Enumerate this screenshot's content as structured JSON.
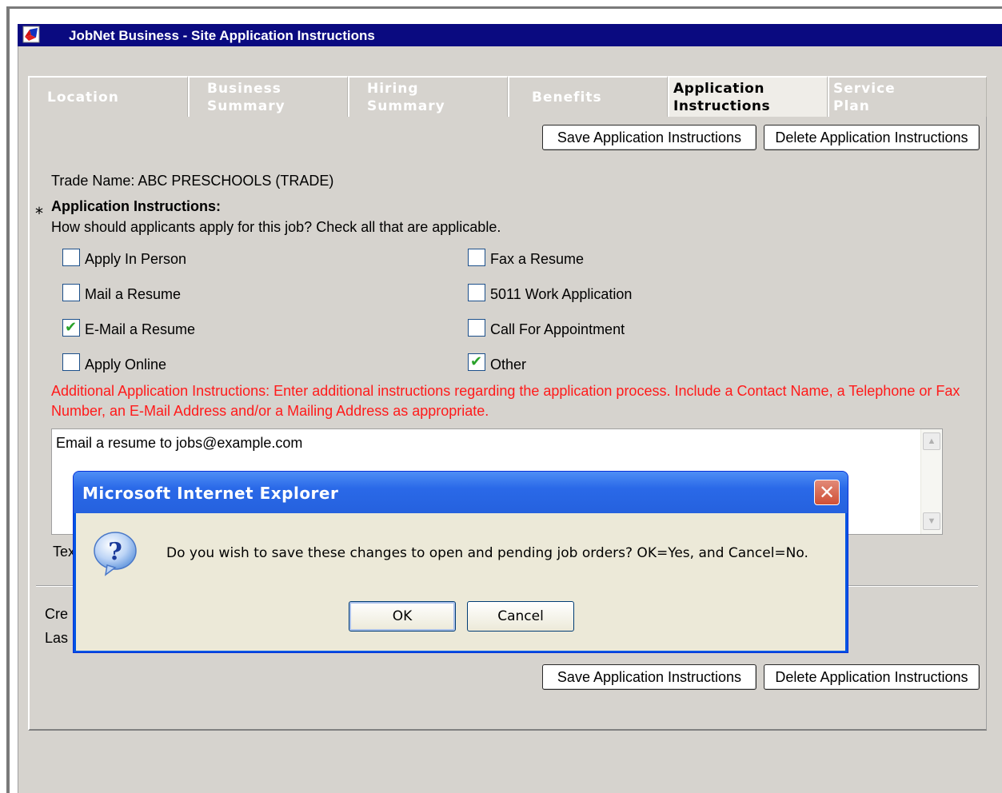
{
  "window": {
    "title": "JobNet Business - Site Application Instructions"
  },
  "tabs": [
    {
      "label": "Location"
    },
    {
      "label_line1": "Business",
      "label_line2": "Summary"
    },
    {
      "label_line1": "Hiring",
      "label_line2": "Summary"
    },
    {
      "label": "Benefits"
    },
    {
      "label_line1": "Application",
      "label_line2": "Instructions",
      "active": true
    },
    {
      "label_line1": "Service",
      "label_line2": "Plan"
    }
  ],
  "toolbar": {
    "save_label": "Save Application Instructions",
    "delete_label": "Delete Application Instructions"
  },
  "form": {
    "trade_name": "Trade Name: ABC PRESCHOOLS (TRADE)",
    "required_marker": "*",
    "section_label": "Application Instructions:",
    "prompt": "How should applicants apply for this job? Check all that are applicable.",
    "options_left": [
      {
        "label": "Apply In Person",
        "checked": false
      },
      {
        "label": "Mail a Resume",
        "checked": false
      },
      {
        "label": "E-Mail a Resume",
        "checked": true
      },
      {
        "label": "Apply Online",
        "checked": false
      }
    ],
    "options_right": [
      {
        "label": "Fax a Resume",
        "checked": false
      },
      {
        "label": "5011 Work Application",
        "checked": false
      },
      {
        "label": "Call For Appointment",
        "checked": false
      },
      {
        "label": "Other",
        "checked": true
      }
    ],
    "check_mark": "✔",
    "additional_instructions_note": "Additional Application Instructions: Enter additional instructions regarding the application process. Include a Contact Name, a Telephone or Fax Number, an E-Mail Address and/or a Mailing Address as appropriate.",
    "additional_instructions_value": "Email a resume to jobs@example.com",
    "partial_label_text": "Tex",
    "partial_label_created": "Cre",
    "partial_label_last": "Las"
  },
  "scroll": {
    "up": "▲",
    "down": "▼"
  },
  "dialog": {
    "title": "Microsoft Internet Explorer",
    "close_glyph": "✕",
    "message": "Do you wish to save these changes to open and pending job orders?  OK=Yes, and Cancel=No.",
    "ok_label": "OK",
    "cancel_label": "Cancel"
  },
  "colors": {
    "titlebar": "#0a0a80",
    "required_note": "#ff1a1a",
    "dialog_title": "#2a69e8",
    "panel_bg": "#d6d3ce"
  }
}
